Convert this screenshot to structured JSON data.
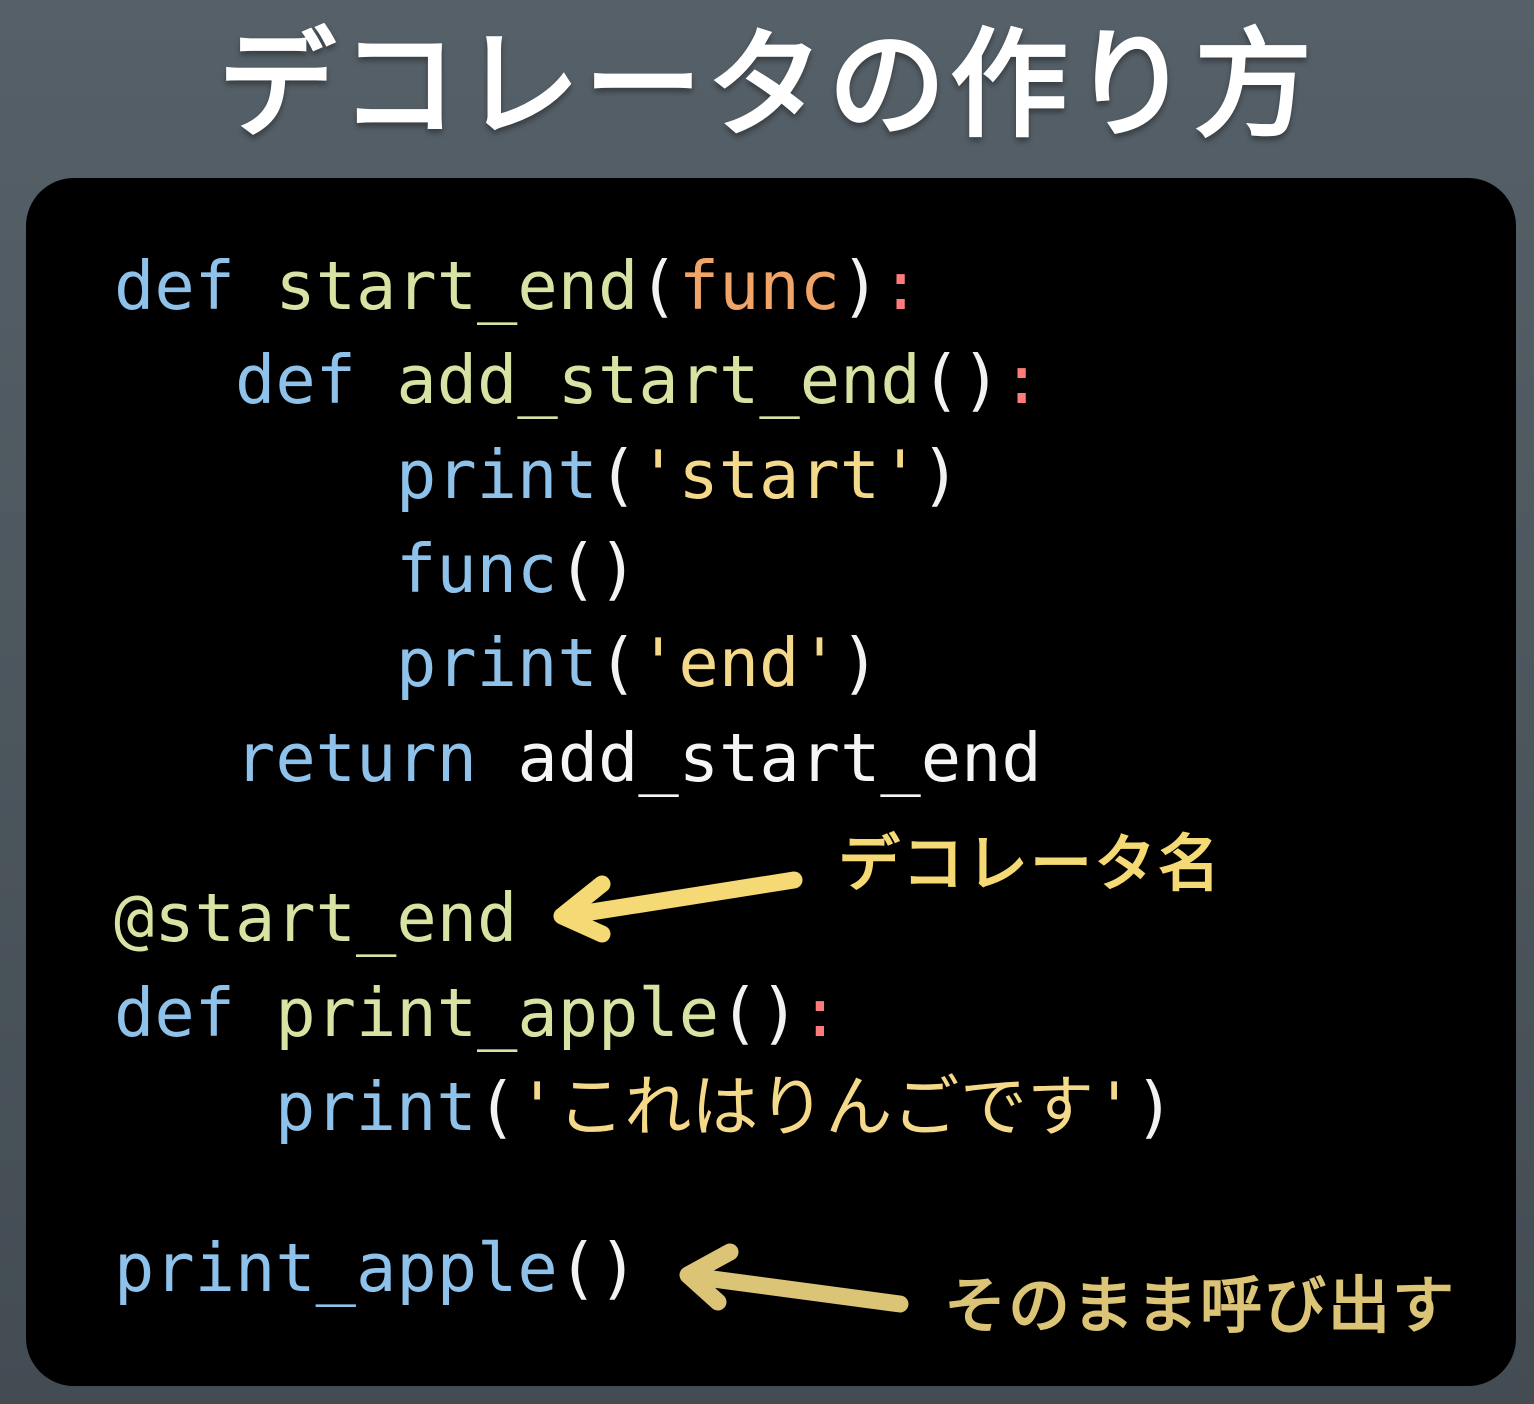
{
  "title": "デコレータの作り方",
  "code": {
    "line1": {
      "kw": "def",
      "name": "start_end",
      "open": "(",
      "param": "func",
      "close": ")",
      "colon": ":"
    },
    "line2": {
      "kw": "def",
      "name": "add_start_end",
      "parens": "()",
      "colon": ":"
    },
    "line3": {
      "call": "print",
      "open": "(",
      "str": "'start'",
      "close": ")"
    },
    "line4": {
      "call": "func",
      "parens": "()"
    },
    "line5": {
      "call": "print",
      "open": "(",
      "str": "'end'",
      "close": ")"
    },
    "line6": {
      "kw": "return",
      "value": "add_start_end"
    },
    "line7": {
      "decorator": "@start_end"
    },
    "line8": {
      "kw": "def",
      "name": "print_apple",
      "parens": "()",
      "colon": ":"
    },
    "line9": {
      "call": "print",
      "open": "(",
      "str": "'これはりんごです'",
      "close": ")"
    },
    "line10": {
      "call": "print_apple",
      "parens": "()"
    }
  },
  "annotations": {
    "decorator_name": "デコレータ名",
    "call_as_is": "そのまま呼び出す"
  },
  "colors": {
    "keyword": "#8fc2ea",
    "function_name": "#d6e3a3",
    "parameter": "#f0a468",
    "string": "#f4d98a",
    "colon": "#ff7b7b",
    "annotation_top": "#f5d974",
    "annotation_bottom": "#dcc476"
  }
}
